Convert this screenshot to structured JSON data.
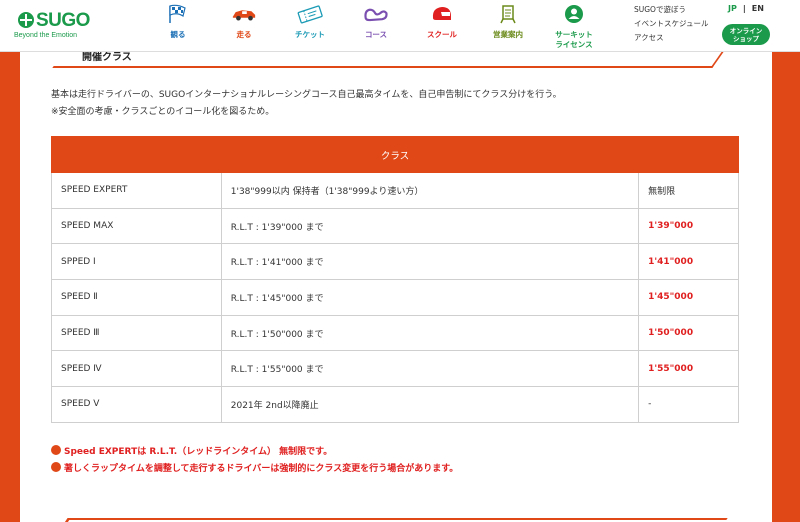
{
  "brand": {
    "logo_text": "SUGO",
    "tagline": "Beyond the Emotion",
    "color": "#1a9a4a"
  },
  "nav": [
    {
      "label": "観る",
      "icon": "checkered-flag-icon",
      "color": "#1a6fb5"
    },
    {
      "label": "走る",
      "icon": "race-car-icon",
      "color": "#e04818"
    },
    {
      "label": "チケット",
      "icon": "ticket-icon",
      "color": "#1a9ab5"
    },
    {
      "label": "コース",
      "icon": "course-map-icon",
      "color": "#7a4fb0"
    },
    {
      "label": "スクール",
      "icon": "helmet-icon",
      "color": "#e02020"
    },
    {
      "label": "営業案内",
      "icon": "signboard-icon",
      "color": "#6b8a1a"
    },
    {
      "label": "サーキット\nライセンス",
      "icon": "license-person-icon",
      "color": "#1a9a4a"
    }
  ],
  "utility": {
    "links": [
      "SUGOで遊ぼう",
      "イベントスケジュール",
      "アクセス"
    ],
    "lang_jp": "JP",
    "lang_sep": "|",
    "lang_en": "EN",
    "shop_label": "オンライン\nショップ"
  },
  "section": {
    "heading": "開催クラス",
    "intro": [
      "基本は走行ドライバーの、SUGOインターナショナルレーシングコース自己最高タイムを、自己申告制にてクラス分けを行う。",
      "※安全面の考慮・クラスごとのイコール化を図るため。"
    ]
  },
  "table": {
    "header": "クラス",
    "rows": [
      {
        "name": "SPEED EXPERT",
        "condition": "1'38\"999以内 保持者（1'38\"999より速い方）",
        "limit": "無制限",
        "highlight": false
      },
      {
        "name": "SPEED MAX",
        "condition": "R.L.T : 1'39\"000 まで",
        "limit": "1'39\"000",
        "highlight": true
      },
      {
        "name": "SPPED Ⅰ",
        "condition": "R.L.T : 1'41\"000 まで",
        "limit": "1'41\"000",
        "highlight": true
      },
      {
        "name": "SPEED Ⅱ",
        "condition": "R.L.T : 1'45\"000 まで",
        "limit": "1'45\"000",
        "highlight": true
      },
      {
        "name": "SPEED Ⅲ",
        "condition": "R.L.T : 1'50\"000 まで",
        "limit": "1'50\"000",
        "highlight": true
      },
      {
        "name": "SPEED Ⅳ",
        "condition": "R.L.T : 1'55\"000 まで",
        "limit": "1'55\"000",
        "highlight": true
      },
      {
        "name": "SPEED Ⅴ",
        "condition": "2021年 2nd以降廃止",
        "limit": "-",
        "highlight": false
      }
    ]
  },
  "notes": [
    "Speed EXPERTは R.L.T.（レッドラインタイム） 無制限です。",
    "著しくラップタイムを調整して走行するドライバーは強制的にクラス変更を行う場合があります。"
  ],
  "colors": {
    "accent": "#e04818",
    "highlight_text": "#e02020",
    "brand_green": "#1a9a4a"
  }
}
